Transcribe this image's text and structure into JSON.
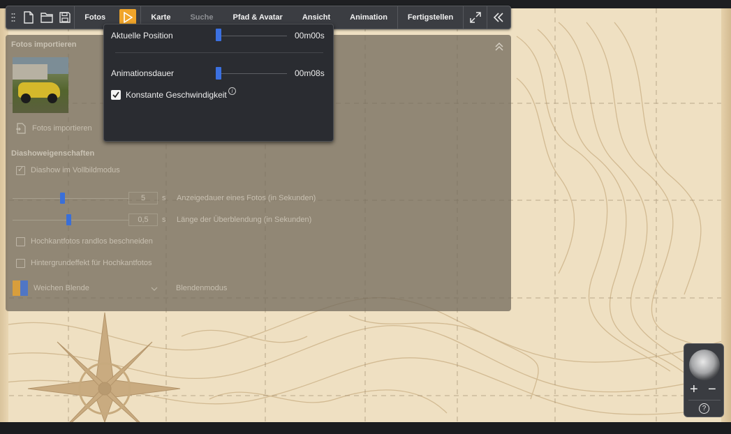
{
  "toolbar": {
    "photos_label": "Fotos",
    "map_label": "Karte",
    "search_label": "Suche",
    "path_avatar_label": "Pfad & Avatar",
    "view_label": "Ansicht",
    "animation_label": "Animation",
    "finish_label": "Fertigstellen"
  },
  "popover": {
    "current_position_label": "Aktuelle Position",
    "current_position_value": "00m00s",
    "current_position_fraction": 0.0,
    "duration_label": "Animationsdauer",
    "duration_value": "00m08s",
    "duration_fraction": 0.0,
    "constant_speed_label": "Konstante Geschwindigkeit",
    "constant_speed_checked": true,
    "info_glyph": "i"
  },
  "panel": {
    "import_heading": "Fotos importieren",
    "import_button_label": "Fotos importieren",
    "slideshow_heading": "Diashoweigenschaften",
    "fullscreen_label": "Diashow im Vollbildmodus",
    "fullscreen_checked": true,
    "display_duration_value": "5",
    "display_duration_unit": "s",
    "display_duration_label": "Anzeigedauer eines Fotos (in Sekunden)",
    "crossfade_value": "0,5",
    "crossfade_unit": "s",
    "crossfade_label": "Länge der Überblendung (in Sekunden)",
    "crop_portrait_label": "Hochkantfotos randlos beschneiden",
    "crop_portrait_checked": false,
    "background_effect_label": "Hintergrundeffekt für Hochkantfotos",
    "background_effect_checked": false,
    "blend_mode_value": "Weichen Blende",
    "blend_mode_label": "Blendenmodus"
  },
  "zoom": {
    "plus": "+",
    "minus": "−",
    "help": "?"
  },
  "colors": {
    "accent": "#f0a52a",
    "slider_knob": "#3b70e0",
    "map_bg": "#efe0c2"
  }
}
